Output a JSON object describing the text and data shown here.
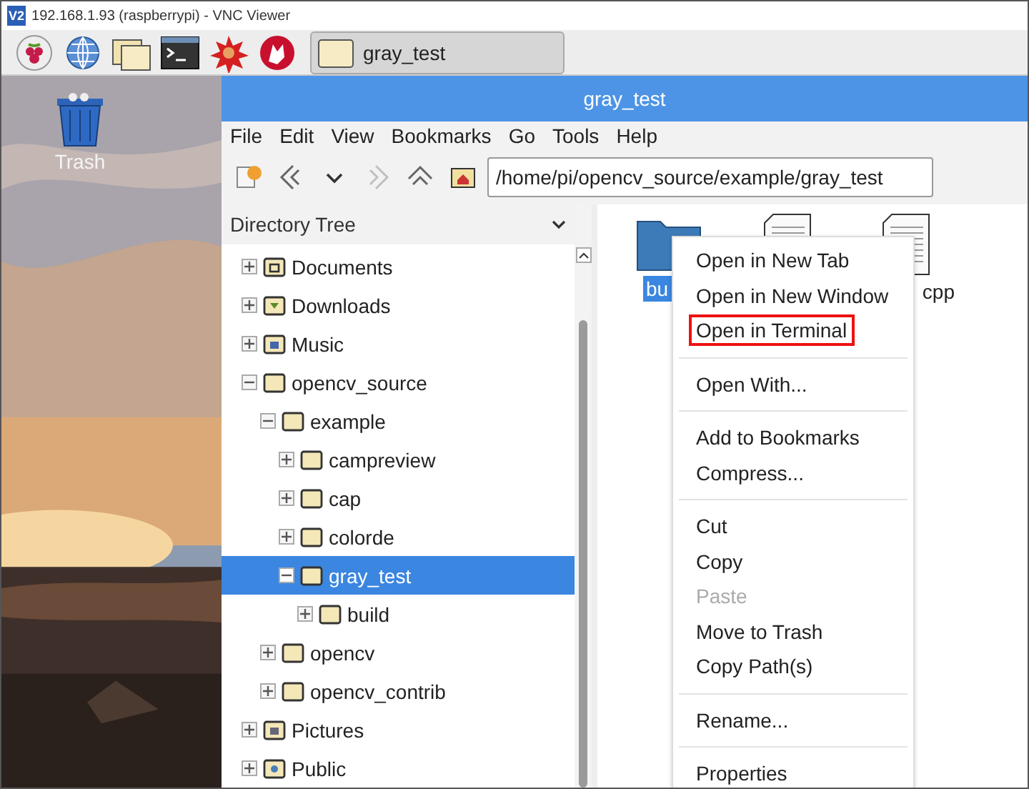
{
  "vnc_window": {
    "badge": "V2",
    "title": "192.168.1.93 (raspberrypi) - VNC Viewer"
  },
  "taskbar": {
    "launchers": [
      {
        "kind": "raspberry"
      },
      {
        "kind": "globe"
      },
      {
        "kind": "folders"
      },
      {
        "kind": "terminal"
      },
      {
        "kind": "burst"
      },
      {
        "kind": "wolf"
      }
    ],
    "tasks": [
      {
        "label": "gray_test",
        "selected": true
      }
    ]
  },
  "desktop": {
    "icons": [
      {
        "label": "Trash"
      }
    ]
  },
  "file_manager": {
    "title": "gray_test",
    "menu": [
      "File",
      "Edit",
      "View",
      "Bookmarks",
      "Go",
      "Tools",
      "Help"
    ],
    "toolbar": {
      "buttons": [
        {
          "kind": "new-tab",
          "disabled": false
        },
        {
          "kind": "back",
          "disabled": false
        },
        {
          "kind": "history",
          "disabled": false
        },
        {
          "kind": "forward",
          "disabled": true
        },
        {
          "kind": "up",
          "disabled": false
        },
        {
          "kind": "home",
          "disabled": false
        }
      ],
      "path": "/home/pi/opencv_source/example/gray_test"
    },
    "sidebar": {
      "title": "Directory Tree",
      "tree": [
        {
          "label": "Documents",
          "kind": "documents",
          "expanded": false,
          "selected": false
        },
        {
          "label": "Downloads",
          "kind": "downloads",
          "expanded": false,
          "selected": false
        },
        {
          "label": "Music",
          "kind": "music",
          "expanded": false,
          "selected": false
        },
        {
          "label": "opencv_source",
          "expanded": true,
          "selected": false,
          "children": [
            {
              "label": "example",
              "expanded": true,
              "selected": false,
              "children": [
                {
                  "label": "campreview",
                  "expanded": false,
                  "selected": false
                },
                {
                  "label": "cap",
                  "expanded": false,
                  "selected": false
                },
                {
                  "label": "colorde",
                  "expanded": false,
                  "selected": false
                },
                {
                  "label": "gray_test",
                  "expanded": true,
                  "selected": true,
                  "children": [
                    {
                      "label": "build",
                      "expanded": false,
                      "selected": false
                    }
                  ]
                }
              ]
            },
            {
              "label": "opencv",
              "expanded": false,
              "selected": false
            },
            {
              "label": "opencv_contrib",
              "expanded": false,
              "selected": false
            }
          ]
        },
        {
          "label": "Pictures",
          "kind": "pictures",
          "expanded": false,
          "selected": false
        },
        {
          "label": "Public",
          "kind": "public",
          "expanded": false,
          "selected": false
        }
      ]
    },
    "files": [
      {
        "kind": "folder",
        "label": "bu",
        "selected": true
      },
      {
        "kind": "document",
        "selected": false
      },
      {
        "kind": "document",
        "label": "cpp",
        "selected": false
      }
    ],
    "context_menu": {
      "groups": [
        [
          {
            "label": "Open in New Tab",
            "disabled": false,
            "marked": false
          },
          {
            "label": "Open in New Window",
            "disabled": false,
            "marked": false
          },
          {
            "label": "Open in Terminal",
            "disabled": false,
            "marked": true
          }
        ],
        [
          {
            "label": "Open With...",
            "disabled": false,
            "marked": false
          }
        ],
        [
          {
            "label": "Add to Bookmarks",
            "disabled": false,
            "marked": false
          },
          {
            "label": "Compress...",
            "disabled": false,
            "marked": false
          }
        ],
        [
          {
            "label": "Cut",
            "disabled": false,
            "marked": false
          },
          {
            "label": "Copy",
            "disabled": false,
            "marked": false
          },
          {
            "label": "Paste",
            "disabled": true,
            "marked": false
          },
          {
            "label": "Move to Trash",
            "disabled": false,
            "marked": false
          },
          {
            "label": "Copy Path(s)",
            "disabled": false,
            "marked": false
          }
        ],
        [
          {
            "label": "Rename...",
            "disabled": false,
            "marked": false
          }
        ],
        [
          {
            "label": "Properties",
            "disabled": false,
            "marked": false
          }
        ]
      ]
    }
  }
}
